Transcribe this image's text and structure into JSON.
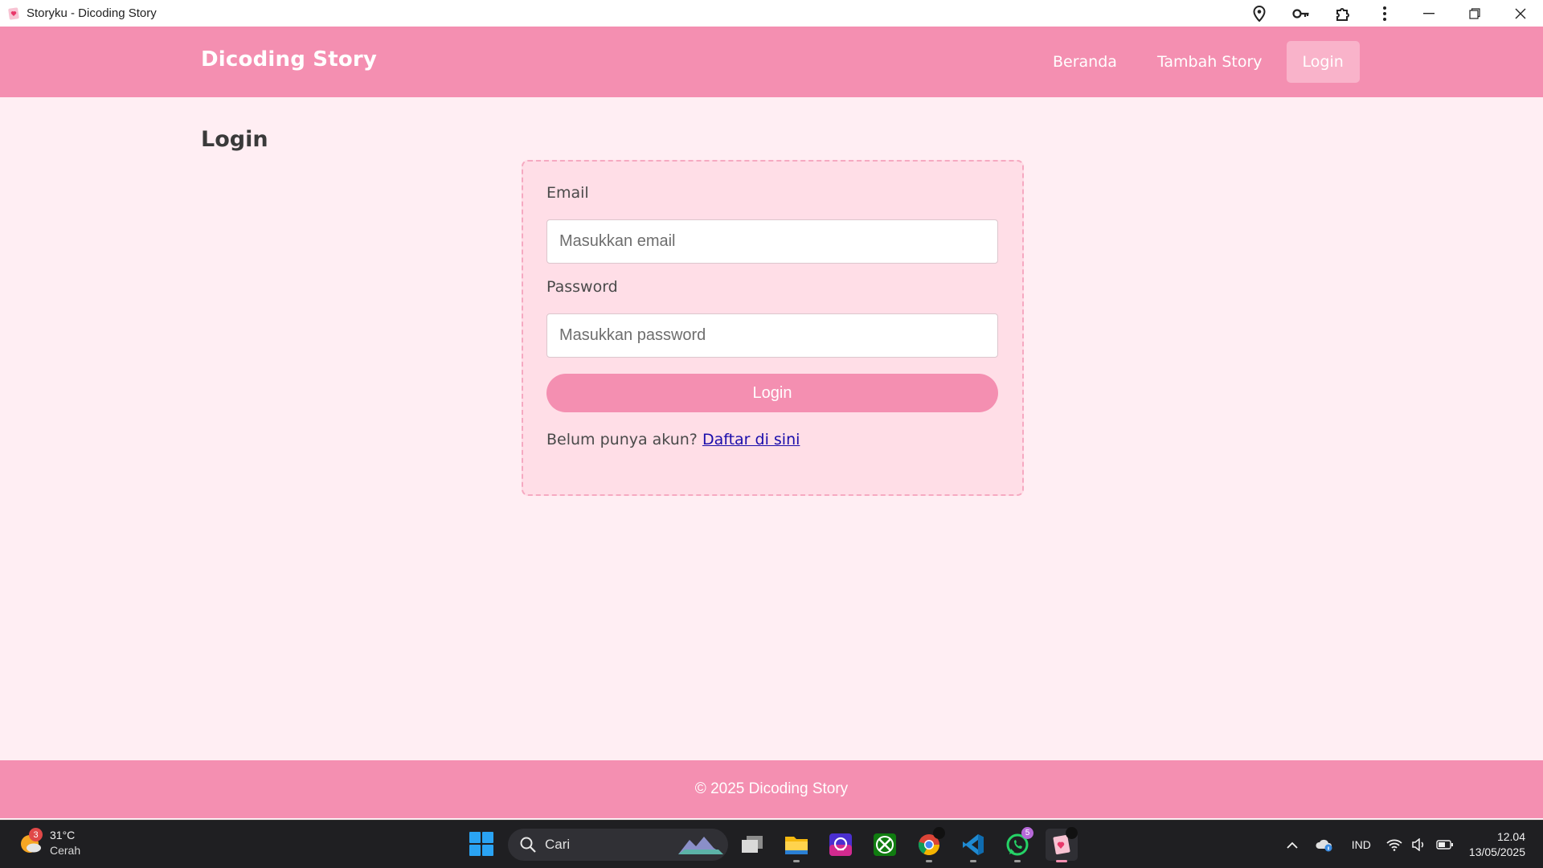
{
  "window": {
    "title": "Storyku - Dicoding Story"
  },
  "navbar": {
    "brand": "Dicoding Story",
    "links": [
      {
        "label": "Beranda"
      },
      {
        "label": "Tambah Story"
      },
      {
        "label": "Login",
        "active": true
      }
    ]
  },
  "page": {
    "title": "Login"
  },
  "form": {
    "email_label": "Email",
    "email_placeholder": "Masukkan email",
    "email_value": "",
    "password_label": "Password",
    "password_placeholder": "Masukkan password",
    "password_value": "",
    "submit_label": "Login",
    "register_prompt": "Belum punya akun?",
    "register_link": "Daftar di sini"
  },
  "footer": {
    "text": "© 2025 Dicoding Story"
  },
  "taskbar": {
    "weather": {
      "badge": "3",
      "temp": "31°C",
      "condition": "Cerah"
    },
    "search_placeholder": "Cari",
    "whatsapp_badge": "5",
    "language": "IND",
    "time": "12.04",
    "date": "13/05/2025"
  },
  "colors": {
    "primary": "#f48fb1",
    "background": "#ffeef3",
    "card": "#ffdee7",
    "link": "#1a0dab"
  },
  "icons": {
    "titlebar": [
      "location-pin-icon",
      "key-icon",
      "extension-puzzle-icon",
      "more-vertical-icon"
    ],
    "window_controls": [
      "minimize-icon",
      "restore-icon",
      "close-icon"
    ],
    "taskbar_apps": [
      "task-view",
      "file-explorer",
      "copilot-app",
      "xbox",
      "chrome",
      "vscode",
      "whatsapp",
      "storyku-app"
    ]
  }
}
